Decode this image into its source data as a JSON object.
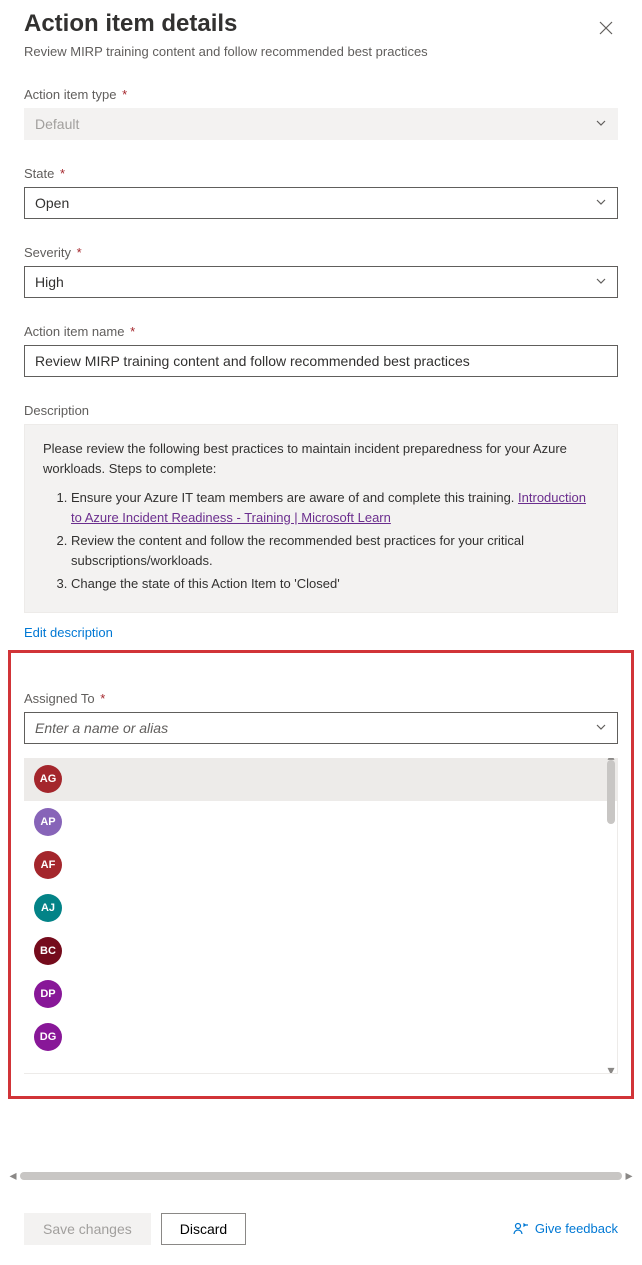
{
  "header": {
    "title": "Action item details",
    "subtitle": "Review MIRP training content and follow recommended best practices"
  },
  "fields": {
    "actionItemType": {
      "label": "Action item type",
      "value": "Default"
    },
    "state": {
      "label": "State",
      "value": "Open"
    },
    "severity": {
      "label": "Severity",
      "value": "High"
    },
    "actionItemName": {
      "label": "Action item name",
      "value": "Review MIRP training content and follow recommended best practices"
    },
    "description": {
      "label": "Description",
      "intro": "Please review the following best practices to maintain incident preparedness for your Azure workloads. Steps to complete:",
      "steps": [
        {
          "text": "Ensure your Azure IT team members are aware of and complete this training.",
          "link": "Introduction to Azure Incident Readiness - Training | Microsoft Learn"
        },
        {
          "text": "Review the content and follow the recommended best practices for your critical subscriptions/workloads."
        },
        {
          "text": "Change the state of this Action Item to 'Closed'"
        }
      ],
      "editLink": "Edit description"
    },
    "assignedTo": {
      "label": "Assigned To",
      "placeholder": "Enter a name or alias",
      "people": [
        {
          "initials": "AG",
          "color": "#a4262c"
        },
        {
          "initials": "AP",
          "color": "#8764b8"
        },
        {
          "initials": "AF",
          "color": "#a4262c"
        },
        {
          "initials": "AJ",
          "color": "#038387"
        },
        {
          "initials": "BC",
          "color": "#750b1c"
        },
        {
          "initials": "DP",
          "color": "#881798"
        },
        {
          "initials": "DG",
          "color": "#881798"
        }
      ]
    }
  },
  "footer": {
    "save": "Save changes",
    "discard": "Discard",
    "feedback": "Give feedback"
  }
}
